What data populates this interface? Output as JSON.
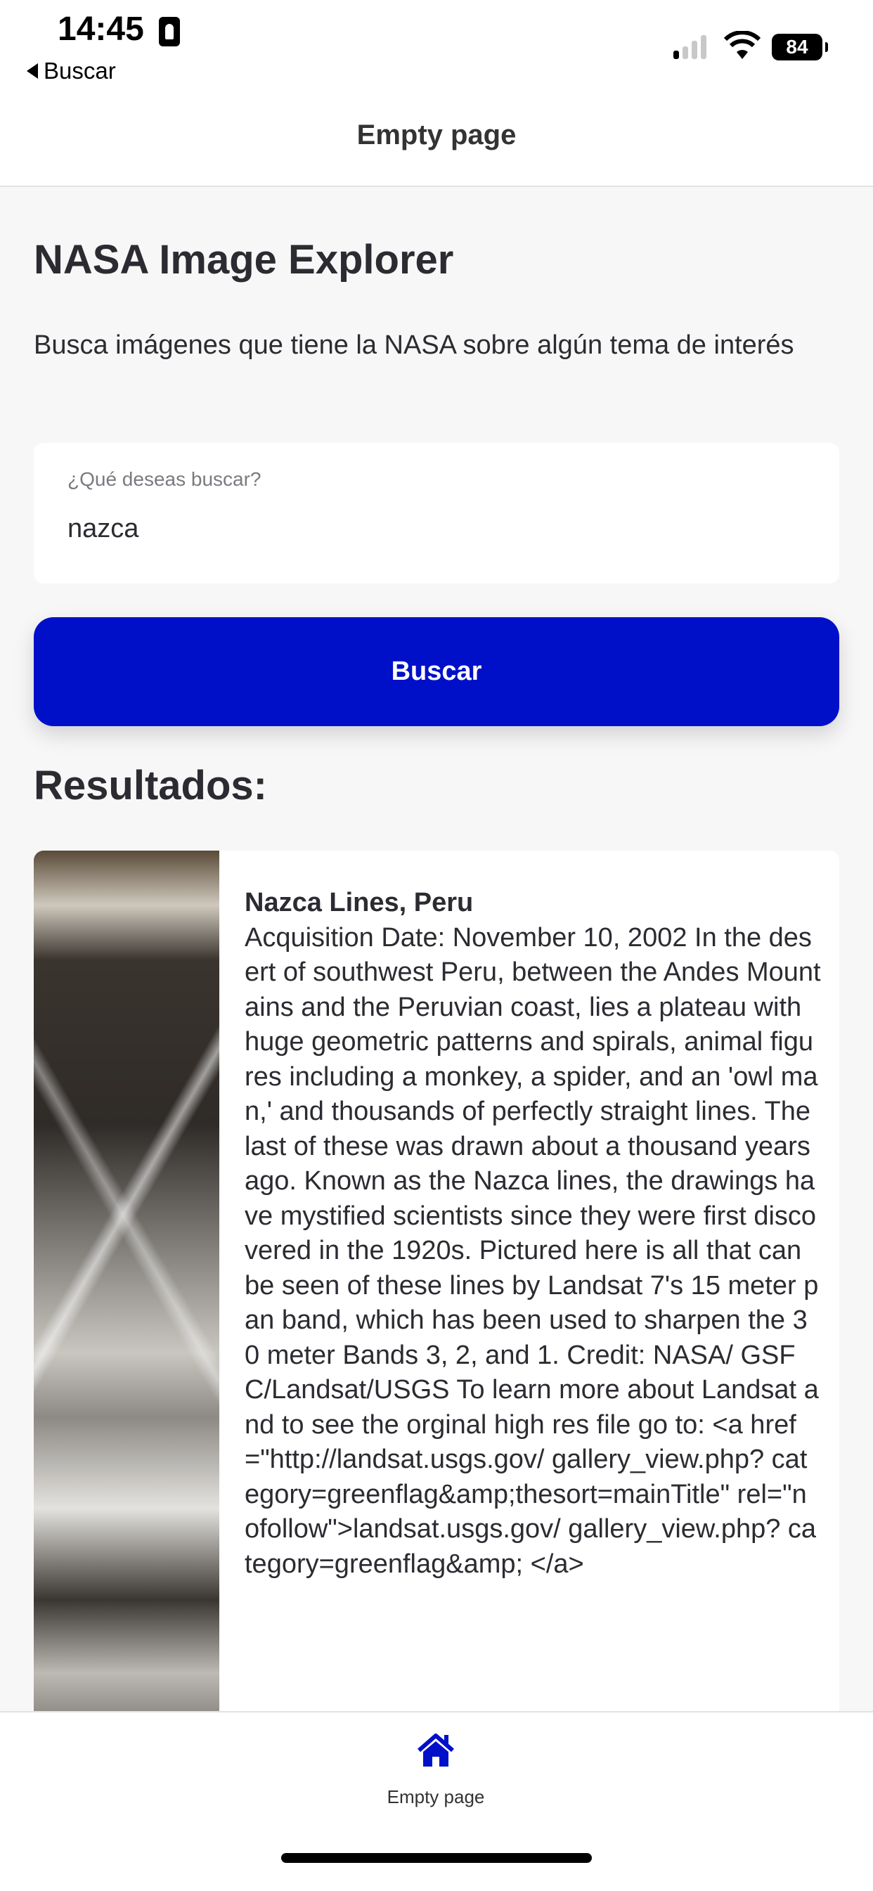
{
  "status_bar": {
    "time": "14:45",
    "back_label": "Buscar",
    "battery": "84"
  },
  "nav": {
    "title": "Empty page"
  },
  "main": {
    "title": "NASA Image Explorer",
    "description": "Busca imágenes que tiene la NASA sobre algún tema de interés",
    "search": {
      "label": "¿Qué deseas buscar?",
      "value": "nazca"
    },
    "search_button": "Buscar",
    "results_heading": "Resultados:",
    "results": [
      {
        "title": "Nazca Lines, Peru",
        "description": "Acquisition Date: November 10, 2002   In the desert of southwest Peru, between the Andes Mountains and the Peruvian coast, lies a plateau with huge geometric patterns and spirals, animal figures including a monkey, a spider, and an 'owl man,' and thousands of perfectly straight lines. The last of these was drawn about a thousand years ago. Known as the Nazca lines, the drawings have mystified scientists since they were first discovered in the 1920s. Pictured here is all that can be seen of these lines by Landsat 7's 15 meter pan band, which has been used to sharpen the 30 meter Bands 3, 2, and 1.   Credit:  NASA/ GSFC/Landsat/USGS  To learn more about Landsat and to see the orginal high res file go to:  <a href=\"http://landsat.usgs.gov/ gallery_view.php? category=greenflag&amp;thesort=mainTitle\" rel=\"nofollow\">landsat.usgs.gov/ gallery_view.php? category=greenflag&amp;  </a>"
      }
    ]
  },
  "tabbar": {
    "items": [
      {
        "label": "Empty page",
        "icon": "home-icon",
        "active": true
      }
    ]
  },
  "colors": {
    "accent": "#0010c8",
    "background": "#f7f7f7"
  }
}
